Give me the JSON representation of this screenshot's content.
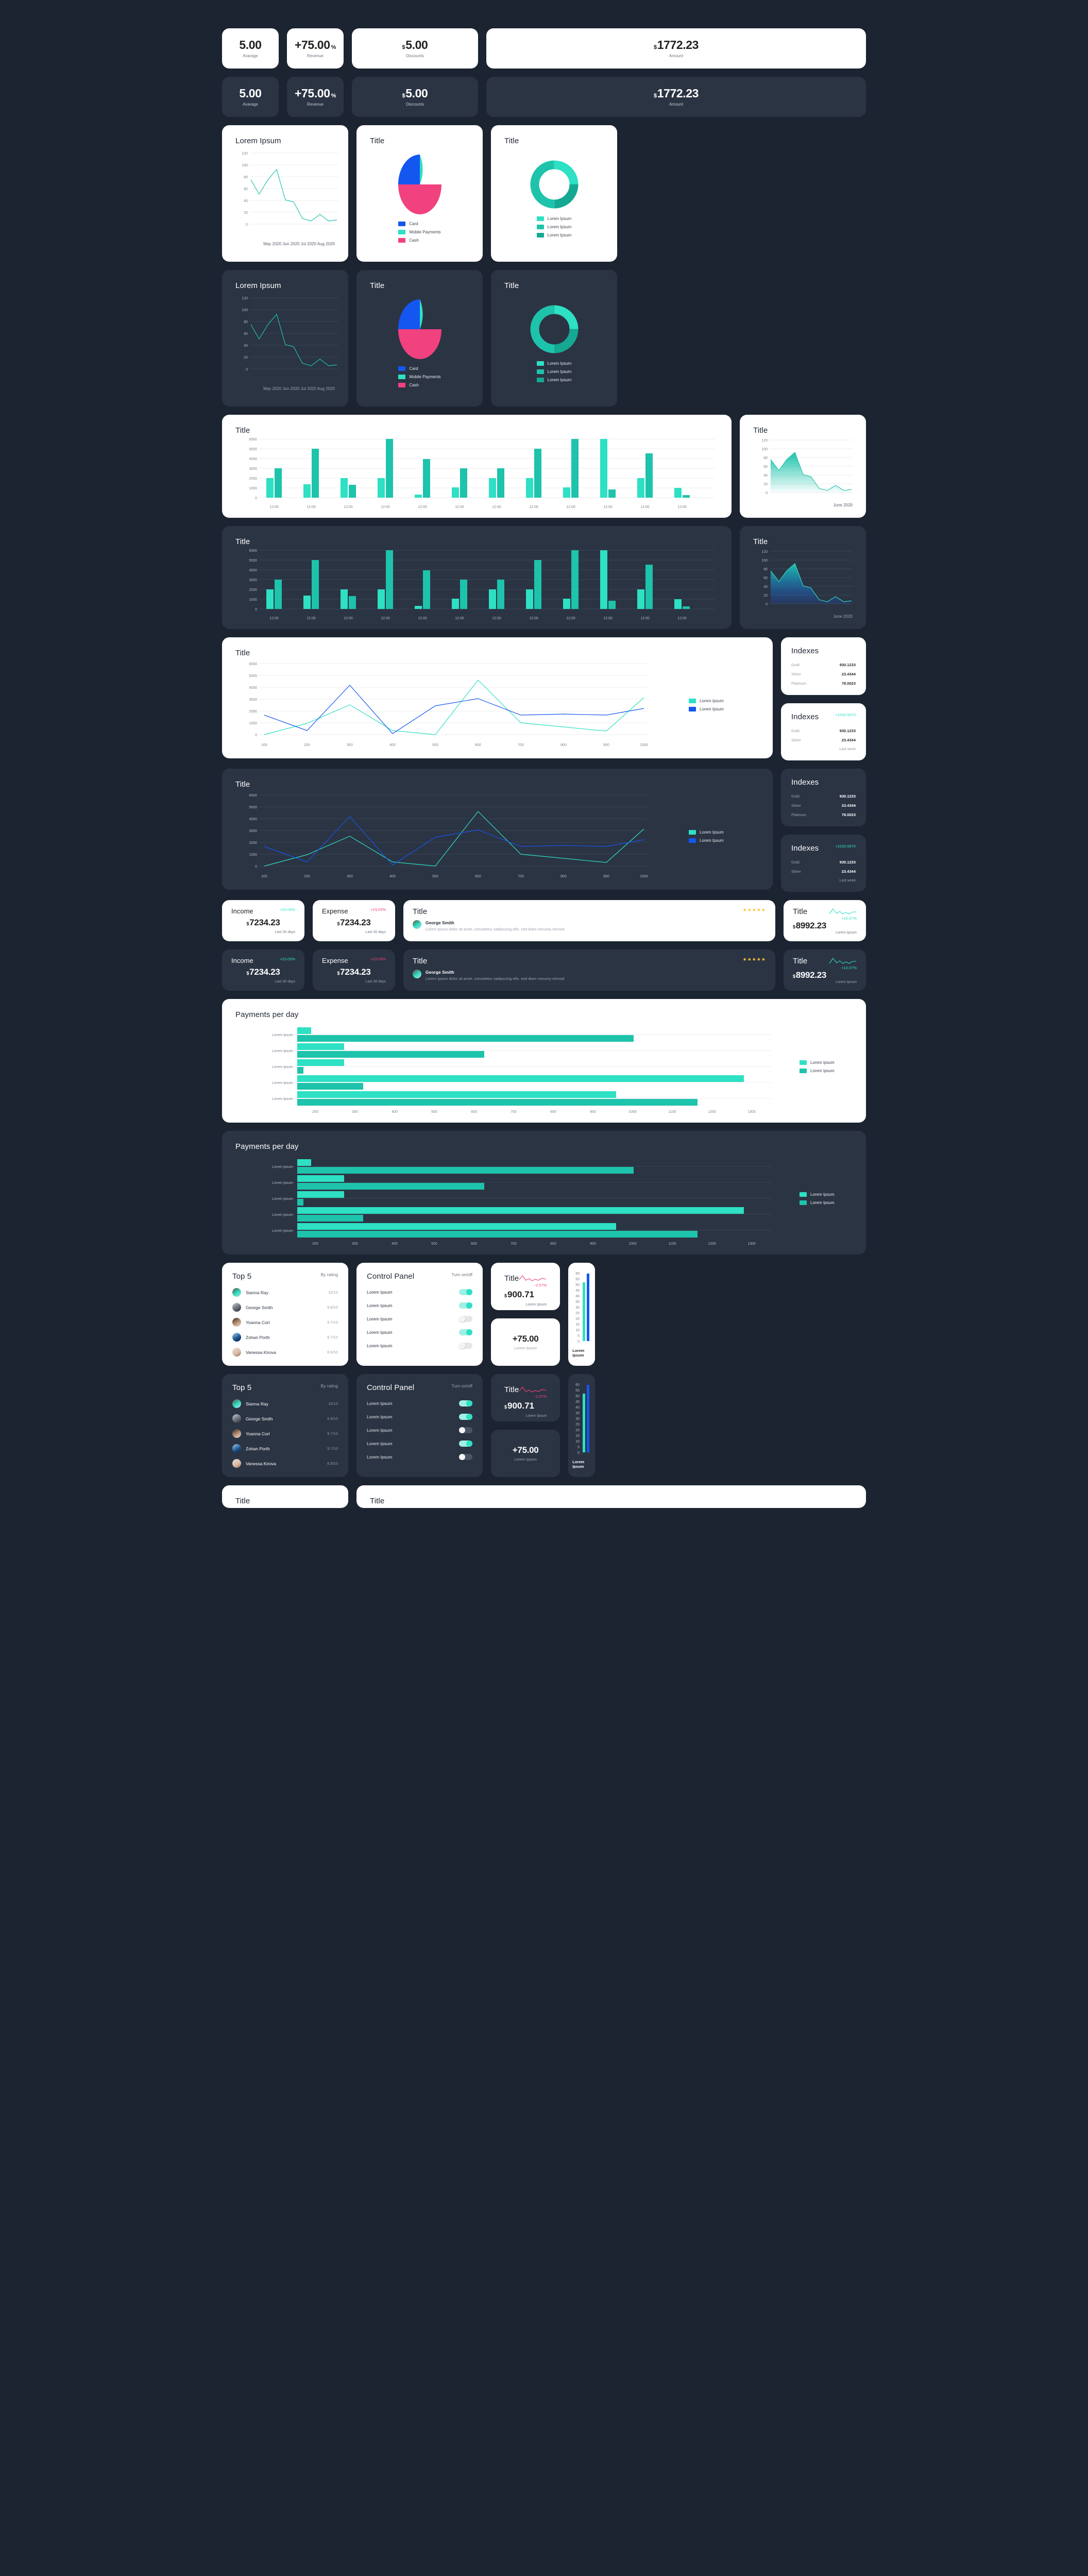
{
  "theme": {
    "bg": "#1b2430",
    "card_light": "#ffffff",
    "card_dark": "#2b3443",
    "accent": "#2ee0c4",
    "accent_mid": "#1ec3ab",
    "accent_dark": "#15a892",
    "blue": "#1456f0",
    "pink": "#f1417f",
    "star": "#ffc233"
  },
  "kpi_cards": [
    {
      "value": "5.00",
      "currency": "",
      "suffix": "",
      "label": "Avarage"
    },
    {
      "value": "+75.00",
      "currency": "",
      "suffix": "%",
      "label": "Revenue"
    },
    {
      "value": "5.00",
      "currency": "$",
      "suffix": "",
      "label": "Discounts"
    },
    {
      "value": "1772.23",
      "currency": "$",
      "suffix": "",
      "label": "Amount"
    }
  ],
  "titles": {
    "lorem_ipsum": "Lorem Ipsum",
    "title": "Title",
    "indexes": "Indexes",
    "payments_per_day": "Payments per day",
    "top5": "Top 5",
    "control_panel": "Control Panel"
  },
  "labels": {
    "by_rating": "By rating",
    "turn_on_off": "Turn on/off",
    "last_30_days": "Last 30 days",
    "last_week": "Last week",
    "lorem_ipsum": "Lorem Ipsum",
    "june_2020": "June 2020"
  },
  "chart_data": [
    {
      "id": "line_lorem",
      "type": "line",
      "title": "Lorem Ipsum",
      "x": [
        "May 2020",
        "Jun 2020",
        "Jul 2020",
        "Aug 2020"
      ],
      "tick_labels": [
        "May 2020",
        "Jun 2020",
        "Jul 2020",
        "Aug 2020"
      ],
      "yticks": [
        0,
        20,
        40,
        60,
        80,
        100,
        120
      ],
      "ylim": [
        0,
        130
      ],
      "values": [
        75,
        50,
        75,
        92,
        41,
        37,
        9,
        5,
        16,
        5,
        7
      ],
      "series_color": "#1ec3ab",
      "grid": true
    },
    {
      "id": "pie_payments",
      "type": "pie",
      "title": "Title",
      "categories": [
        "Card",
        "Mobile Payments",
        "Cash"
      ],
      "values": [
        25,
        25,
        50
      ],
      "colors": [
        "#1456f0",
        "#2ee0c4",
        "#f1417f"
      ],
      "legend": "bottom"
    },
    {
      "id": "donut_lorem",
      "type": "pie",
      "title": "Title",
      "categories": [
        "Lorem Ipsum",
        "Lorem Ipsum",
        "Lorem Ipsum"
      ],
      "values": [
        25,
        50,
        25
      ],
      "colors": [
        "#2ee0c4",
        "#1ec3ab",
        "#15a892"
      ],
      "legend": "bottom",
      "donut": true
    },
    {
      "id": "bars_12",
      "type": "bar",
      "title": "Title",
      "categories": [
        "12:00",
        "12:00",
        "12:00",
        "12:00",
        "12:00",
        "12:00",
        "12:00",
        "12:00",
        "12:00",
        "12:00",
        "12:00",
        "12:00"
      ],
      "yticks": [
        0,
        1000,
        2000,
        3000,
        4000,
        5000,
        6000
      ],
      "ylim": [
        0,
        6300
      ],
      "series": [
        {
          "name": "Lorem Ipsum",
          "color": "#2ee0c4",
          "values": [
            2000,
            1370,
            2010,
            2010,
            320,
            1070,
            2010,
            2010,
            1070,
            6010,
            2010,
            1010
          ]
        },
        {
          "name": "Lorem Ipsum",
          "color": "#1ec3ab",
          "values": [
            3010,
            4990,
            1340,
            6010,
            3960,
            3010,
            3010,
            4990,
            5990,
            820,
            4560,
            260
          ]
        }
      ]
    },
    {
      "id": "area_june",
      "type": "area",
      "title": "Title",
      "footer": "June 2020",
      "yticks": [
        0,
        20,
        40,
        60,
        80,
        100,
        120
      ],
      "ylim": [
        0,
        130
      ],
      "values": [
        75,
        50,
        75,
        92,
        41,
        37,
        9,
        5,
        16,
        5,
        7
      ],
      "series_color": "#1ec3ab"
    },
    {
      "id": "multiline",
      "type": "line",
      "title": "Title",
      "x": [
        100,
        200,
        300,
        400,
        500,
        600,
        700,
        800,
        900,
        1000
      ],
      "xticks": [
        100,
        200,
        300,
        400,
        500,
        600,
        700,
        800,
        900,
        1000
      ],
      "yticks": [
        0,
        1000,
        2000,
        3000,
        4000,
        5000,
        6000
      ],
      "ylim": [
        0,
        6300
      ],
      "series": [
        {
          "name": "Lorem Ipsum",
          "color": "#2ee0c4",
          "values": [
            20,
            960,
            2540,
            330,
            20,
            4590,
            980,
            660,
            320,
            3140
          ]
        },
        {
          "name": "Lorem Ipsum",
          "color": "#1456f0",
          "values": [
            1660,
            340,
            4180,
            80,
            2430,
            3030,
            1650,
            1760,
            1650,
            2230
          ]
        }
      ]
    },
    {
      "id": "ppd_bars",
      "type": "bar",
      "orientation": "horizontal",
      "title": "Payments per day",
      "categories": [
        "Lorem Ipsum",
        "Lorem Ipsum",
        "Lorem Ipsum",
        "Lorem Ipsum",
        "Lorem Ipsum"
      ],
      "xticks": [
        200,
        300,
        400,
        500,
        600,
        700,
        800,
        900,
        1000,
        1100,
        1200,
        1300
      ],
      "xlim": [
        150,
        1350
      ],
      "series": [
        {
          "name": "Lorem Ipsum",
          "color": "#2ee0c4",
          "values": [
            185,
            275,
            275,
            1280,
            930
          ]
        },
        {
          "name": "Lorem Ipsum",
          "color": "#1ec3ab",
          "values": [
            1000,
            610,
            165,
            315,
            1160
          ]
        }
      ]
    },
    {
      "id": "gauge_bars",
      "type": "bar",
      "orientation": "vertical",
      "yticks": [
        0,
        5,
        10,
        15,
        20,
        25,
        30,
        35,
        40,
        45,
        50,
        55,
        60
      ],
      "ylim": [
        0,
        61
      ],
      "footer": "Lorem Ipsum",
      "series": [
        {
          "name": "Lorem Ipsum",
          "color": "#2ee0c4",
          "values": [
            52
          ]
        },
        {
          "name": "Lorem Ipsum",
          "color": "#1456f0",
          "values": [
            59
          ]
        }
      ]
    }
  ],
  "indexes_plain": {
    "title": "Indexes",
    "rows": [
      {
        "name": "Gold",
        "value": "930.1233"
      },
      {
        "name": "Silver",
        "value": "23.4344"
      },
      {
        "name": "Platinum",
        "value": "78.0023"
      }
    ]
  },
  "indexes_delta": {
    "title": "Indexes",
    "delta": "+1033.5670",
    "rows": [
      {
        "name": "Gold",
        "value": "930.1233"
      },
      {
        "name": "Silver",
        "value": "23.4344"
      }
    ],
    "footer": "Last week"
  },
  "income_card": {
    "title": "Income",
    "delta": "+23.03%",
    "currency": "$",
    "value": "7234.23",
    "footer": "Last 30 days"
  },
  "expense_card": {
    "title": "Expense",
    "delta": "+23.03%",
    "currency": "$",
    "value": "7234.23",
    "footer": "Last 30 days"
  },
  "review_card": {
    "title": "Title",
    "stars": "★★★★★",
    "person": "George Smith",
    "text": "Lorem ipsum dolor sit amet, consetetur sadipscing elitr, sed diam nonumy eirmod"
  },
  "spark_card": {
    "title": "Title",
    "delta": "+10.07%",
    "currency": "$",
    "value": "8992.23",
    "footer": "Lorem Ipsum"
  },
  "money_card": {
    "title": "Title",
    "delta": "-2.07%",
    "currency": "$",
    "value": "900.71",
    "footer": "Lorem Ipsum"
  },
  "plus_card": {
    "value": "+75.00",
    "label": "Lorem Ipsum"
  },
  "top5": {
    "title": "Top 5",
    "action": "By rating",
    "rows": [
      {
        "name": "Sianna Ray",
        "value": "10/10"
      },
      {
        "name": "George Smith",
        "value": "9.8/10"
      },
      {
        "name": "Yoanna Corl",
        "value": "9.7/10"
      },
      {
        "name": "Zohan Porth",
        "value": "9.7/10"
      },
      {
        "name": "Vanessa Kirova",
        "value": "8.9/10"
      }
    ]
  },
  "control_panel": {
    "title": "Control Panel",
    "action": "Turn on/off",
    "rows": [
      {
        "label": "Lorem Ipsum",
        "on": true
      },
      {
        "label": "Lorem Ipsum",
        "on": true
      },
      {
        "label": "Lorem Ipsum",
        "on": false
      },
      {
        "label": "Lorem Ipsum",
        "on": true
      },
      {
        "label": "Lorem Ipsum",
        "on": false
      }
    ]
  }
}
